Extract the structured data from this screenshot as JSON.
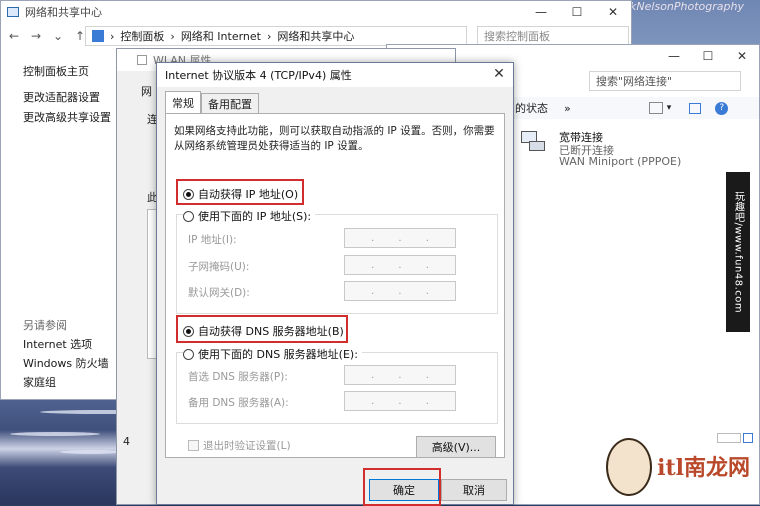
{
  "desktop": {
    "brand": "rkNelsonPhotography"
  },
  "nsc": {
    "title": "网络和共享中心",
    "address": [
      "控制面板",
      "网络和 Internet",
      "网络和共享中心"
    ],
    "search_placeholder": "搜索控制面板",
    "sidebar_top": [
      "控制面板主页",
      "更改适配器设置",
      "更改高级共享设置"
    ],
    "see_also_heading": "另请参阅",
    "see_also": [
      "Internet 选项",
      "Windows 防火墙",
      "家庭组"
    ]
  },
  "connections": {
    "search_placeholder": "搜索\"网络连接\"",
    "toolbar_text": "的状态",
    "toolbar_more": "»",
    "item": {
      "name": "宽带连接",
      "status": "已断开连接",
      "device": "WAN Miniport (PPPOE)"
    }
  },
  "wlan": {
    "title": "WLAN 属性",
    "tab_partial": "网",
    "left_fragments": [
      "连",
      "此",
      "4"
    ]
  },
  "dialog": {
    "title": "Internet 协议版本 4 (TCP/IPv4) 属性",
    "close": "✕",
    "tabs": [
      "常规",
      "备用配置"
    ],
    "description": "如果网络支持此功能，则可以获取自动指派的 IP 设置。否则，你需要从网络系统管理员处获得适当的 IP 设置。",
    "auto_ip": "自动获得 IP 地址(O)",
    "manual_ip": "使用下面的 IP 地址(S):",
    "ip_fields": [
      "IP 地址(I):",
      "子网掩码(U):",
      "默认网关(D):"
    ],
    "auto_dns": "自动获得 DNS 服务器地址(B)",
    "manual_dns": "使用下面的 DNS 服务器地址(E):",
    "dns_fields": [
      "首选 DNS 服务器(P):",
      "备用 DNS 服务器(A):"
    ],
    "validate_on_exit": "退出时验证设置(L)",
    "advanced": "高级(V)...",
    "ok": "确定",
    "cancel": "取消",
    "highlight_color": "#d12d2d"
  },
  "watermark": {
    "vertical": "玩趣吧/www.fun48.com",
    "logo": "itl南龙网"
  }
}
